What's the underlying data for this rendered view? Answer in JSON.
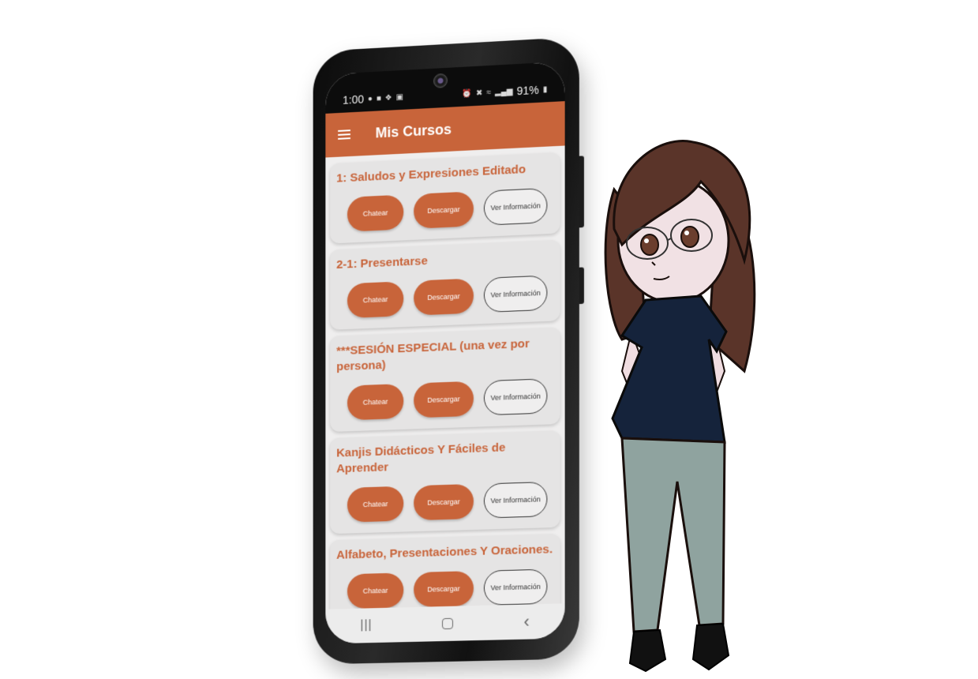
{
  "status_bar": {
    "time": "1:00",
    "battery": "91%",
    "left_icons": [
      "notification-icon",
      "app-icon",
      "signal-misc-icon",
      "image-icon"
    ],
    "right_icons": [
      "alarm-icon",
      "mute-icon",
      "wifi-icon",
      "signal-icon",
      "battery-icon"
    ]
  },
  "app_bar": {
    "title": "Mis Cursos"
  },
  "courses": [
    {
      "title": "1: Saludos y Expresiones Editado",
      "chat_label": "Chatear",
      "download_label": "Descargar",
      "info_label": "Ver Información"
    },
    {
      "title": "2-1: Presentarse",
      "chat_label": "Chatear",
      "download_label": "Descargar",
      "info_label": "Ver Información"
    },
    {
      "title": "***SESIÓN ESPECIAL (una vez por persona)",
      "chat_label": "Chatear",
      "download_label": "Descargar",
      "info_label": "Ver Información"
    },
    {
      "title": "Kanjis Didácticos Y Fáciles de Aprender",
      "chat_label": "Chatear",
      "download_label": "Descargar",
      "info_label": "Ver Información"
    },
    {
      "title": "Alfabeto, Presentaciones Y Oraciones.",
      "chat_label": "Chatear",
      "download_label": "Descargar",
      "info_label": "Ver Información"
    }
  ],
  "nav_bar": {
    "recent_glyph": "|||",
    "back_glyph": "‹"
  },
  "colors": {
    "accent": "#c8643a",
    "card_bg": "#e5e4e4",
    "screen_bg": "#efeeee"
  }
}
